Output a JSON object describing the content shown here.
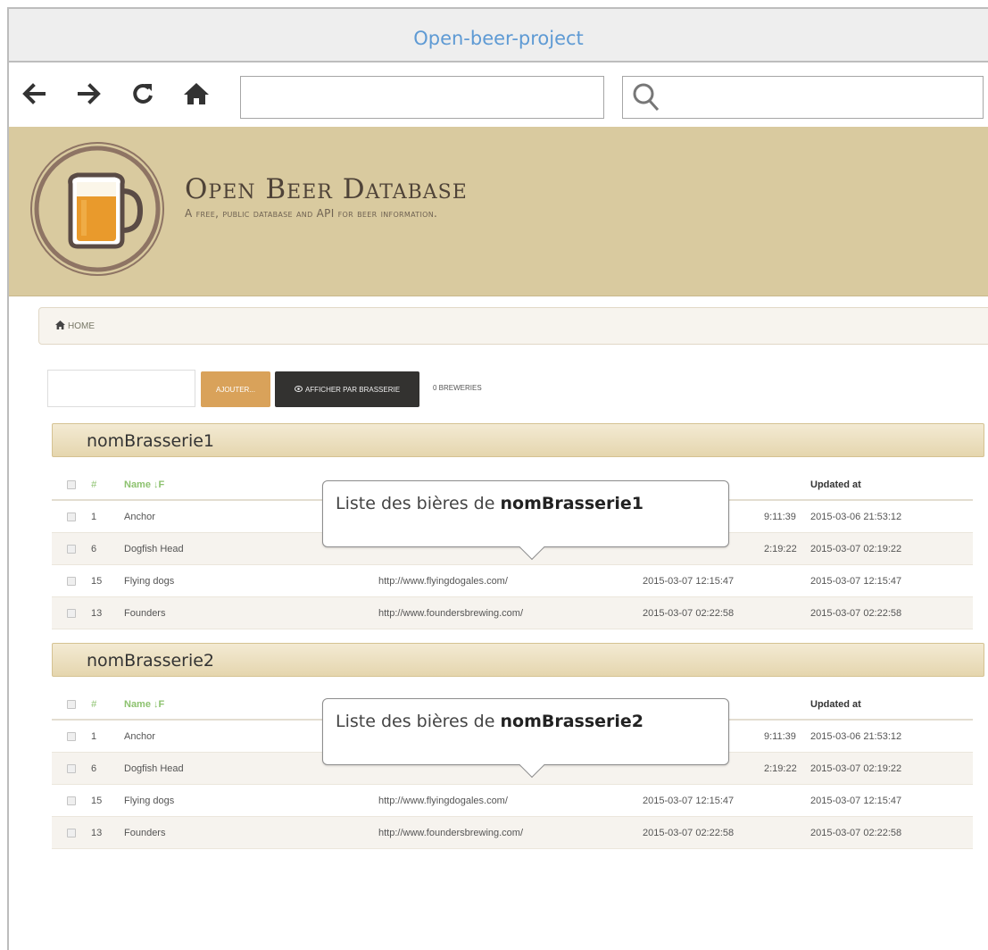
{
  "window": {
    "title": "Open-beer-project"
  },
  "nav": {
    "back_icon": "arrow-left-icon",
    "forward_icon": "arrow-right-icon",
    "reload_icon": "reload-icon",
    "home_icon": "home-icon",
    "url_value": "",
    "search_icon": "magnifier-icon",
    "search_value": ""
  },
  "header": {
    "title": "Open Beer Database",
    "subtitle": "A free, public database and API for beer information.",
    "logo_icon": "beer-mug-icon",
    "bg_color": "#d9ca9f"
  },
  "breadcrumb": {
    "home_icon": "home-icon",
    "home_label": "HOME"
  },
  "toolbar": {
    "input_value": "",
    "add_label": "AJOUTER...",
    "show_label": "AFFICHER PAR BRASSERIE",
    "show_icon": "eye-icon",
    "count_label": "0 BREWERIES",
    "add_color": "#d9a25a",
    "show_color": "#333230"
  },
  "table_headers": {
    "num": "#",
    "name": "Name",
    "sort_icon": "sort-icon",
    "updated": "Updated at"
  },
  "sections": [
    {
      "name": "nomBrasserie1",
      "tooltip_prefix": "Liste des bières de ",
      "tooltip_name": "nomBrasserie1",
      "rows": [
        {
          "num": "1",
          "name": "Anchor",
          "url": "",
          "created": "9:11:39",
          "updated": "2015-03-06 21:53:12"
        },
        {
          "num": "6",
          "name": "Dogfish Head",
          "url": "",
          "created": "2:19:22",
          "updated": "2015-03-07 02:19:22"
        },
        {
          "num": "15",
          "name": "Flying dogs",
          "url": "http://www.flyingdogales.com/",
          "created": "2015-03-07 12:15:47",
          "updated": "2015-03-07 12:15:47"
        },
        {
          "num": "13",
          "name": "Founders",
          "url": "http://www.foundersbrewing.com/",
          "created": "2015-03-07 02:22:58",
          "updated": "2015-03-07 02:22:58"
        }
      ]
    },
    {
      "name": "nomBrasserie2",
      "tooltip_prefix": "Liste des bières de ",
      "tooltip_name": "nomBrasserie2",
      "rows": [
        {
          "num": "1",
          "name": "Anchor",
          "url": "",
          "created": "9:11:39",
          "updated": "2015-03-06 21:53:12"
        },
        {
          "num": "6",
          "name": "Dogfish Head",
          "url": "",
          "created": "2:19:22",
          "updated": "2015-03-07 02:19:22"
        },
        {
          "num": "15",
          "name": "Flying dogs",
          "url": "http://www.flyingdogales.com/",
          "created": "2015-03-07 12:15:47",
          "updated": "2015-03-07 12:15:47"
        },
        {
          "num": "13",
          "name": "Founders",
          "url": "http://www.foundersbrewing.com/",
          "created": "2015-03-07 02:22:58",
          "updated": "2015-03-07 02:22:58"
        }
      ]
    }
  ]
}
